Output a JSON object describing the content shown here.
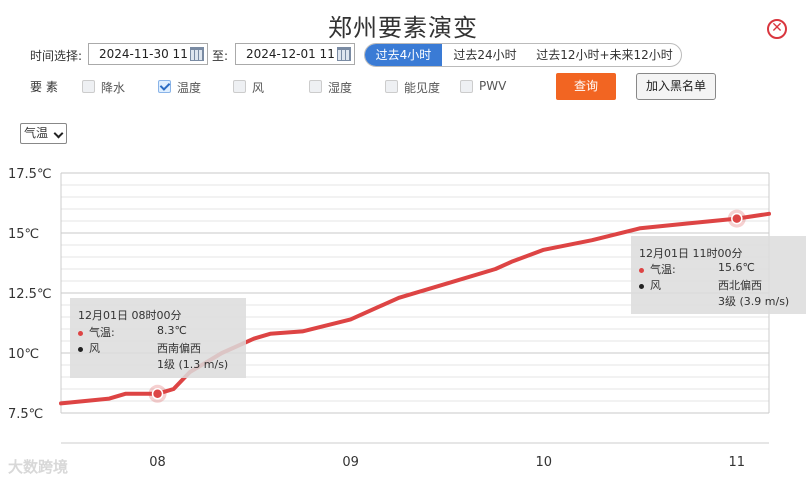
{
  "header": {
    "title": "郑州要素演变"
  },
  "filters": {
    "time_label": "时间选择:",
    "start_date": "2024-11-30 11",
    "to_label": "至:",
    "end_date": "2024-12-01 11",
    "ranges": [
      {
        "label": "过去4小时",
        "active": true
      },
      {
        "label": "过去24小时",
        "active": false
      },
      {
        "label": "过去12小时+未来12小时",
        "active": false
      }
    ]
  },
  "elements": {
    "label": "要 素",
    "items": [
      {
        "label": "降水",
        "checked": false
      },
      {
        "label": "温度",
        "checked": true
      },
      {
        "label": "风",
        "checked": false
      },
      {
        "label": "湿度",
        "checked": false
      },
      {
        "label": "能见度",
        "checked": false
      },
      {
        "label": "PWV",
        "checked": false
      }
    ]
  },
  "buttons": {
    "query": "查询",
    "blacklist": "加入黑名单"
  },
  "variable_select": {
    "value": "气温"
  },
  "chart_data": {
    "type": "line",
    "series": [
      {
        "values": [
          [
            "2024-12-01 07:30",
            7.9
          ],
          [
            "2024-12-01 07:45",
            8.1
          ],
          [
            "2024-12-01 07:50",
            8.3
          ],
          [
            "2024-12-01 08:00",
            8.3
          ],
          [
            "2024-12-01 08:05",
            8.5
          ],
          [
            "2024-12-01 08:10",
            9.2
          ],
          [
            "2024-12-01 08:20",
            10.0
          ],
          [
            "2024-12-01 08:30",
            10.6
          ],
          [
            "2024-12-01 08:35",
            10.8
          ],
          [
            "2024-12-01 08:45",
            10.9
          ],
          [
            "2024-12-01 09:00",
            11.4
          ],
          [
            "2024-12-01 09:15",
            12.3
          ],
          [
            "2024-12-01 09:30",
            12.9
          ],
          [
            "2024-12-01 09:45",
            13.5
          ],
          [
            "2024-12-01 09:50",
            13.8
          ],
          [
            "2024-12-01 10:00",
            14.3
          ],
          [
            "2024-12-01 10:15",
            14.7
          ],
          [
            "2024-12-01 10:30",
            15.2
          ],
          [
            "2024-12-01 10:45",
            15.4
          ],
          [
            "2024-12-01 11:00",
            15.6
          ],
          [
            "2024-12-01 11:10",
            15.8
          ]
        ],
        "color": "#dd4444"
      }
    ],
    "x_ticks": [
      "08",
      "09",
      "10",
      "11"
    ],
    "y_ticks": [
      "7.5℃",
      "10℃",
      "12.5℃",
      "15℃",
      "17.5℃"
    ],
    "ylim": [
      7.5,
      17.5
    ],
    "grid": true,
    "tooltips": [
      {
        "time": "12月01日 08时00分",
        "temp_label": "气温:",
        "temp_value": "8.3℃",
        "wind_label": "风",
        "wind_dir": "西南偏西",
        "wind_speed": "1级 (1.3 m/s)"
      },
      {
        "time": "12月01日 11时00分",
        "temp_label": "气温:",
        "temp_value": "15.6℃",
        "wind_label": "风",
        "wind_dir": "西北偏西",
        "wind_speed": "3级 (3.9 m/s)"
      }
    ]
  },
  "watermark": "大数跨境"
}
